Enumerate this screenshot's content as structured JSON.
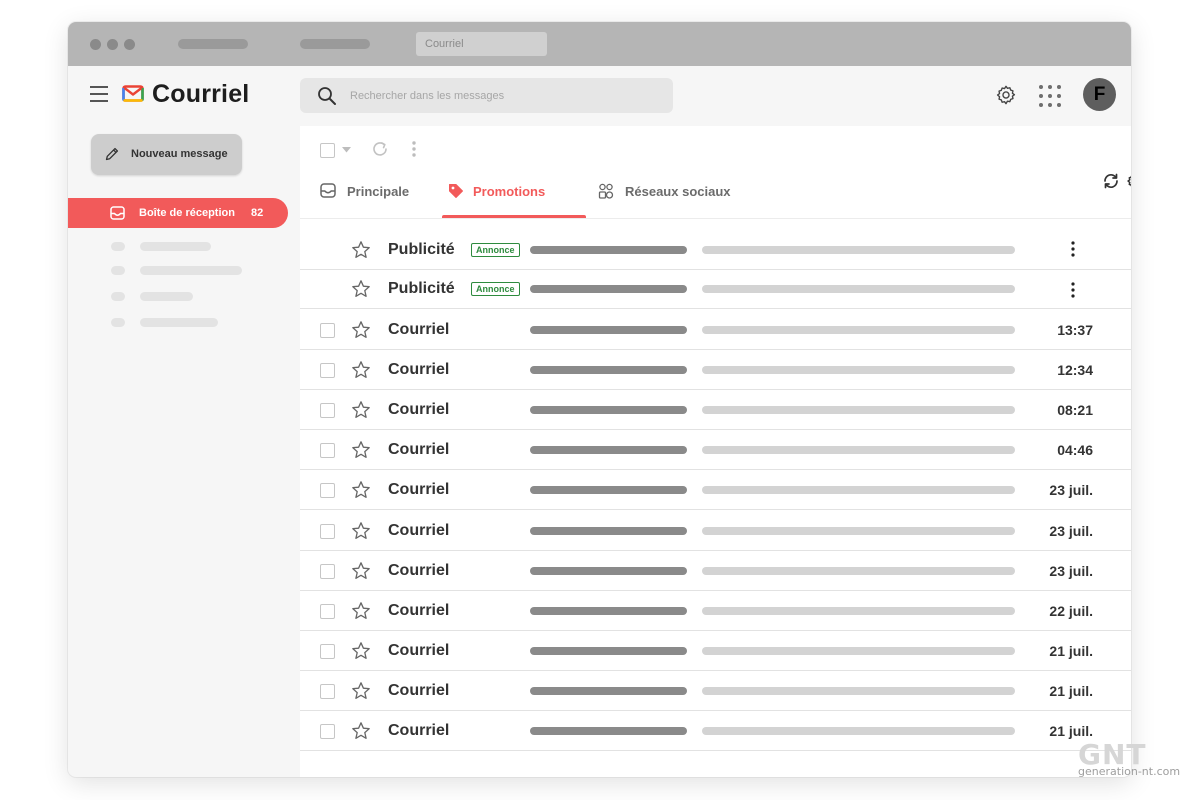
{
  "browser": {
    "tab_title": "Courriel"
  },
  "header": {
    "app_title": "Courriel",
    "search_placeholder": "Rechercher dans les messages",
    "avatar_letter": "F"
  },
  "sidebar": {
    "compose_label": "Nouveau message",
    "inbox_label": "Boîte de réception",
    "inbox_count": "82"
  },
  "tabs": [
    {
      "label": "Principale",
      "active": false,
      "icon": "inbox-icon"
    },
    {
      "label": "Promotions",
      "active": true,
      "icon": "tag-icon"
    },
    {
      "label": "Réseaux sociaux",
      "active": false,
      "icon": "people-icon"
    }
  ],
  "colors": {
    "accent": "#f25a5a",
    "ad_badge": "#2e8b3e",
    "logo": [
      "#ea4335",
      "#fbbc04",
      "#34a853",
      "#4285f4"
    ]
  },
  "messages": [
    {
      "sender": "Publicité",
      "badge": "Annonce",
      "time": "",
      "is_ad": true
    },
    {
      "sender": "Publicité",
      "badge": "Annonce",
      "time": "",
      "is_ad": true
    },
    {
      "sender": "Courriel",
      "time": "13:37"
    },
    {
      "sender": "Courriel",
      "time": "12:34"
    },
    {
      "sender": "Courriel",
      "time": "08:21"
    },
    {
      "sender": "Courriel",
      "time": "04:46"
    },
    {
      "sender": "Courriel",
      "time": "23 juil."
    },
    {
      "sender": "Courriel",
      "time": "23 juil."
    },
    {
      "sender": "Courriel",
      "time": "23 juil."
    },
    {
      "sender": "Courriel",
      "time": "22 juil."
    },
    {
      "sender": "Courriel",
      "time": "21 juil."
    },
    {
      "sender": "Courriel",
      "time": "21 juil."
    },
    {
      "sender": "Courriel",
      "time": "21 juil."
    }
  ],
  "watermark": {
    "logo": "GNT",
    "site": "generation-nt.com"
  }
}
